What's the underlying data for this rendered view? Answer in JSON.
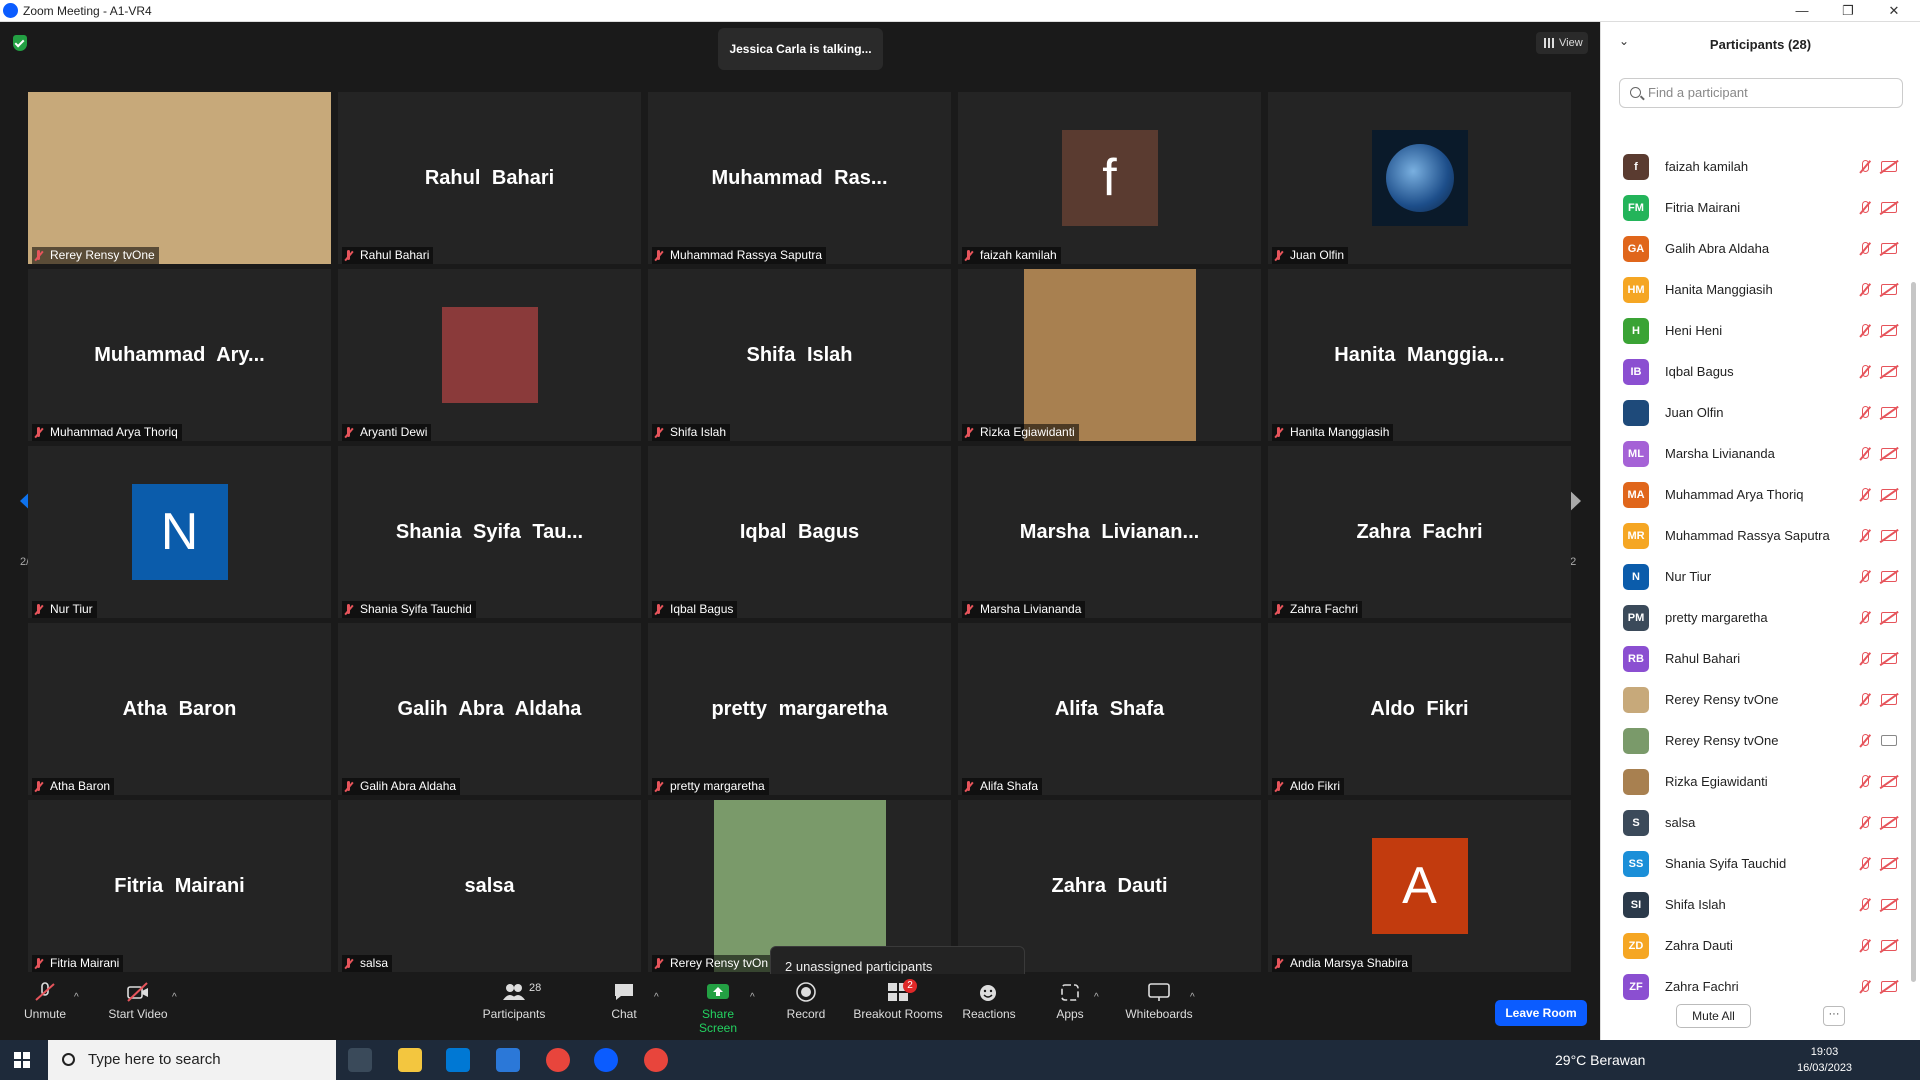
{
  "window": {
    "title": "Zoom Meeting - A1-VR4",
    "minimize": "—",
    "maximize": "❐",
    "close": "✕"
  },
  "stage": {
    "talking": "Jessica Carla is talking...",
    "view_label": "View",
    "page_left": "2/2",
    "page_right": "2/2",
    "tiles": [
      {
        "center": "",
        "label": "Rerey Rensy tvOne",
        "photo": "#c7a97a"
      },
      {
        "center": "Rahul Bahari",
        "label": "Rahul Bahari"
      },
      {
        "center": "Muhammad  Ras...",
        "label": "Muhammad Rassya Saputra"
      },
      {
        "center": "f",
        "label": "faizah kamilah",
        "avatar": "#5a3b30"
      },
      {
        "center": "",
        "label": "Juan Olfin",
        "globe": true
      },
      {
        "center": "Muhammad  Ary...",
        "label": "Muhammad Arya Thoriq"
      },
      {
        "center": "",
        "label": "Aryanti Dewi",
        "small_photo": "#8a3a3a"
      },
      {
        "center": "Shifa Islah",
        "label": "Shifa Islah"
      },
      {
        "center": "",
        "label": "Rizka Egiawidanti",
        "photo": "#a88050"
      },
      {
        "center": "Hanita  Manggia...",
        "label": "Hanita Manggiasih"
      },
      {
        "center": "N",
        "label": "Nur Tiur",
        "avatar": "#0b5cab"
      },
      {
        "center": "Shania  Syifa  Tau...",
        "label": "Shania Syifa Tauchid"
      },
      {
        "center": "Iqbal Bagus",
        "label": "Iqbal Bagus"
      },
      {
        "center": "Marsha  Livianan...",
        "label": "Marsha Liviananda"
      },
      {
        "center": "Zahra Fachri",
        "label": "Zahra Fachri"
      },
      {
        "center": "Atha Baron",
        "label": "Atha Baron"
      },
      {
        "center": "Galih Abra Aldaha",
        "label": "Galih Abra Aldaha"
      },
      {
        "center": "pretty margaretha",
        "label": "pretty margaretha"
      },
      {
        "center": "Alifa Shafa",
        "label": "Alifa Shafa"
      },
      {
        "center": "Aldo Fikri",
        "label": "Aldo Fikri"
      },
      {
        "center": "Fitria Mairani",
        "label": "Fitria Mairani"
      },
      {
        "center": "salsa",
        "label": "salsa"
      },
      {
        "center": "",
        "label": "Rerey Rensy tvOn",
        "photo": "#7a9a6a"
      },
      {
        "center": "Zahra Dauti",
        "label": "auti"
      },
      {
        "center": "A",
        "label": "Andia Marsya Shabira",
        "avatar": "#c23b0e"
      }
    ],
    "tooltip": "2 unassigned participants"
  },
  "toolbar": {
    "unmute": "Unmute",
    "start_video": "Start Video",
    "participants": "Participants",
    "participants_count": "28",
    "chat": "Chat",
    "share_screen": "Share Screen",
    "record": "Record",
    "breakout": "Breakout Rooms",
    "breakout_badge": "2",
    "reactions": "Reactions",
    "apps": "Apps",
    "whiteboards": "Whiteboards",
    "leave": "Leave Room"
  },
  "panel": {
    "title": "Participants (28)",
    "search_placeholder": "Find a participant",
    "mute_all": "Mute All",
    "more": "···",
    "participants": [
      {
        "initials": "f",
        "name": "faizah kamilah",
        "color": "#5a3b30"
      },
      {
        "initials": "FM",
        "name": "Fitria Mairani",
        "color": "#23b45a"
      },
      {
        "initials": "GA",
        "name": "Galih Abra Aldaha",
        "color": "#e0661b"
      },
      {
        "initials": "HM",
        "name": "Hanita Manggiasih",
        "color": "#f5a623"
      },
      {
        "initials": "H",
        "name": "Heni Heni",
        "color": "#3aa335"
      },
      {
        "initials": "IB",
        "name": "Iqbal Bagus",
        "color": "#8b4fd1"
      },
      {
        "initials": "",
        "name": "Juan Olfin",
        "color": "#1e4a7a"
      },
      {
        "initials": "ML",
        "name": "Marsha Liviananda",
        "color": "#a562d6"
      },
      {
        "initials": "MA",
        "name": "Muhammad Arya Thoriq",
        "color": "#e0661b"
      },
      {
        "initials": "MR",
        "name": "Muhammad Rassya Saputra",
        "color": "#f5a623"
      },
      {
        "initials": "N",
        "name": "Nur Tiur",
        "color": "#0b5cab"
      },
      {
        "initials": "PM",
        "name": "pretty margaretha",
        "color": "#3b4a5a"
      },
      {
        "initials": "RB",
        "name": "Rahul Bahari",
        "color": "#8b4fd1"
      },
      {
        "initials": "",
        "name": "Rerey Rensy tvOne",
        "color": "#c7a97a"
      },
      {
        "initials": "",
        "name": "Rerey Rensy tvOne",
        "color": "#7a9a6a",
        "camera_on": true
      },
      {
        "initials": "",
        "name": "Rizka Egiawidanti",
        "color": "#a88050"
      },
      {
        "initials": "S",
        "name": "salsa",
        "color": "#3b4a5a"
      },
      {
        "initials": "SS",
        "name": "Shania Syifa Tauchid",
        "color": "#1b8fd8"
      },
      {
        "initials": "SI",
        "name": "Shifa Islah",
        "color": "#2b3a4a"
      },
      {
        "initials": "ZD",
        "name": "Zahra Dauti",
        "color": "#f5a623"
      },
      {
        "initials": "ZF",
        "name": "Zahra Fachri",
        "color": "#8b4fd1"
      }
    ]
  },
  "taskbar": {
    "search": "Type here to search",
    "weather": "29°C  Berawan",
    "time": "19:03",
    "date": "16/03/2023",
    "notification_count": "3"
  }
}
